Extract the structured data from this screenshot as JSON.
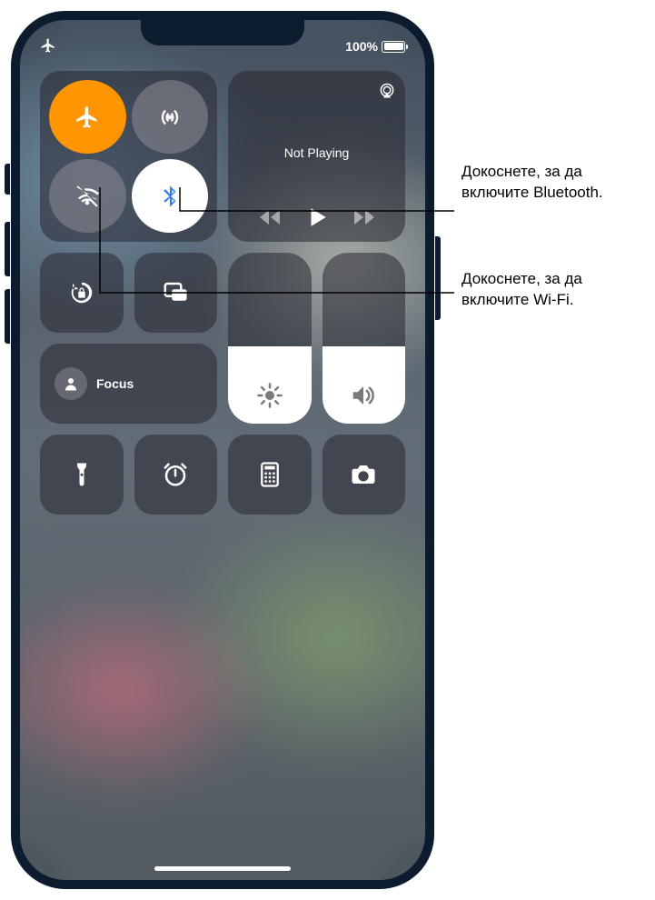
{
  "status": {
    "battery_pct": "100%"
  },
  "media": {
    "title": "Not Playing"
  },
  "focus": {
    "label": "Focus"
  },
  "sliders": {
    "brightness": {
      "pct": 45
    },
    "volume": {
      "pct": 45
    }
  },
  "icons": {
    "airplane": "airplane-icon",
    "cellular": "cellular-antenna-icon",
    "wifi_off": "wifi-off-icon",
    "bluetooth": "bluetooth-icon",
    "airplay": "airplay-icon",
    "orientation_lock": "orientation-lock-icon",
    "screen_mirroring": "screen-mirroring-icon",
    "focus": "person-icon",
    "brightness": "sun-icon",
    "volume": "speaker-icon",
    "flashlight": "flashlight-icon",
    "timer": "timer-icon",
    "calculator": "calculator-icon",
    "camera": "camera-icon",
    "back": "skip-back-icon",
    "play": "play-icon",
    "forward": "skip-forward-icon"
  },
  "callouts": {
    "bluetooth": "Докоснете, за да включите Bluetooth.",
    "wifi": "Докоснете, за да включите Wi-Fi."
  }
}
